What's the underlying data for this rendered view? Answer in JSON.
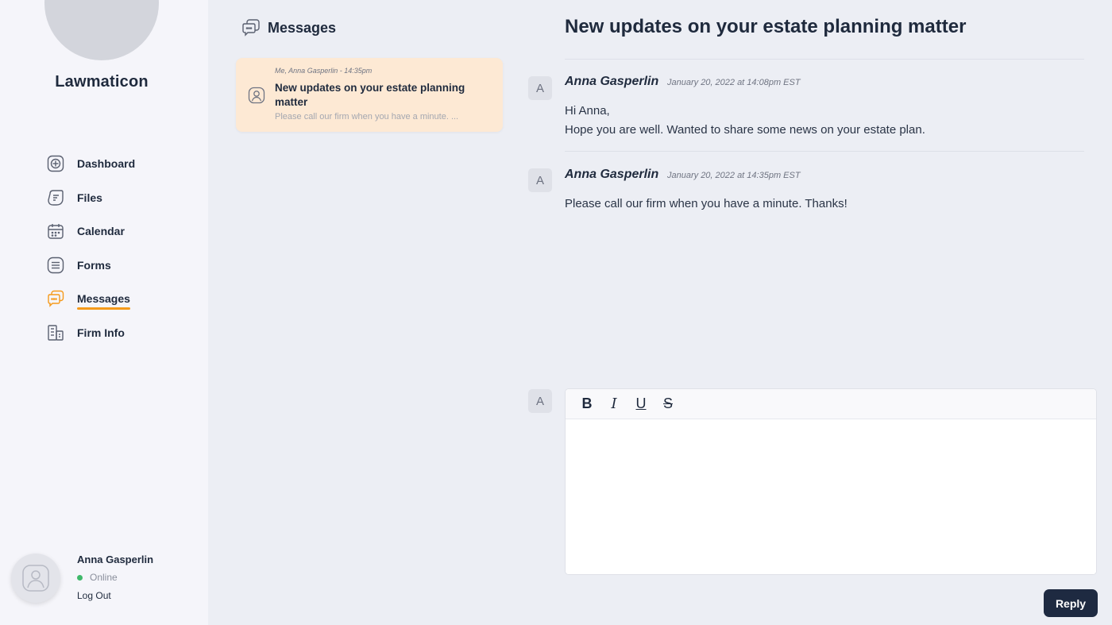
{
  "app": {
    "brand": "Lawmaticon"
  },
  "sidebar": {
    "items": [
      {
        "label": "Dashboard",
        "icon": "dashboard-icon"
      },
      {
        "label": "Files",
        "icon": "files-icon"
      },
      {
        "label": "Calendar",
        "icon": "calendar-icon"
      },
      {
        "label": "Forms",
        "icon": "forms-icon"
      },
      {
        "label": "Messages",
        "icon": "messages-icon",
        "active": true
      },
      {
        "label": "Firm Info",
        "icon": "firm-info-icon"
      }
    ],
    "active_color": "#f59a1b"
  },
  "user": {
    "name": "Anna Gasperlin",
    "status": "Online",
    "status_color": "#3fb86a",
    "logout": "Log Out"
  },
  "list": {
    "title": "Messages",
    "thread": {
      "meta": "Me, Anna Gasperlin - 14:35pm",
      "subject": "New updates on your estate planning matter",
      "preview": "Please call our firm when you have a minute. ..."
    }
  },
  "conversation": {
    "title": "New updates on your estate planning matter",
    "messages": [
      {
        "avatar": "A",
        "author": "Anna Gasperlin",
        "time": "January 20, 2022 at 14:08pm EST",
        "lines": [
          "Hi Anna,",
          "Hope you are well. Wanted to share some news on your estate plan."
        ]
      },
      {
        "avatar": "A",
        "author": "Anna Gasperlin",
        "time": "January 20, 2022 at 14:35pm EST",
        "lines": [
          "Please call our firm when you have a minute. Thanks!"
        ]
      }
    ]
  },
  "composer": {
    "avatar": "A",
    "toolbar": {
      "bold": "B",
      "italic": "I",
      "underline": "U",
      "strike": "S"
    },
    "value": "",
    "reply_label": "Reply",
    "reply_color": "#1e2a41"
  }
}
